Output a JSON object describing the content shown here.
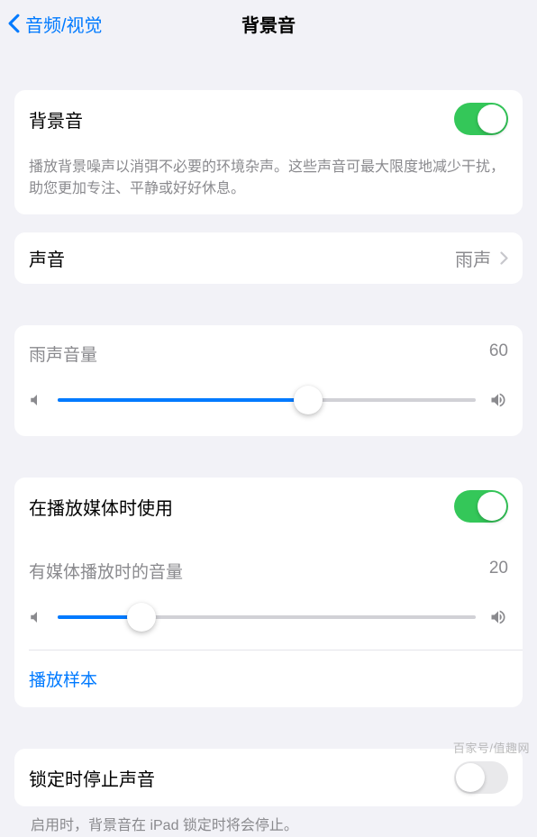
{
  "nav": {
    "back_label": "音频/视觉",
    "title": "背景音"
  },
  "main_toggle": {
    "label": "背景音",
    "on": true,
    "footer": "播放背景噪声以消弭不必要的环境杂声。这些声音可最大限度地减少干扰，助您更加专注、平静或好好休息。"
  },
  "sound_row": {
    "label": "声音",
    "value": "雨声"
  },
  "volume1": {
    "label": "雨声音量",
    "value": 60,
    "percent": 60
  },
  "media": {
    "toggle_label": "在播放媒体时使用",
    "toggle_on": true,
    "volume_label": "有媒体播放时的音量",
    "volume_value": 20,
    "volume_percent": 20,
    "sample_label": "播放样本"
  },
  "lock": {
    "label": "锁定时停止声音",
    "on": false,
    "footer": "启用时，背景音在 iPad 锁定时将会停止。"
  },
  "watermark": "百家号/值趣网"
}
